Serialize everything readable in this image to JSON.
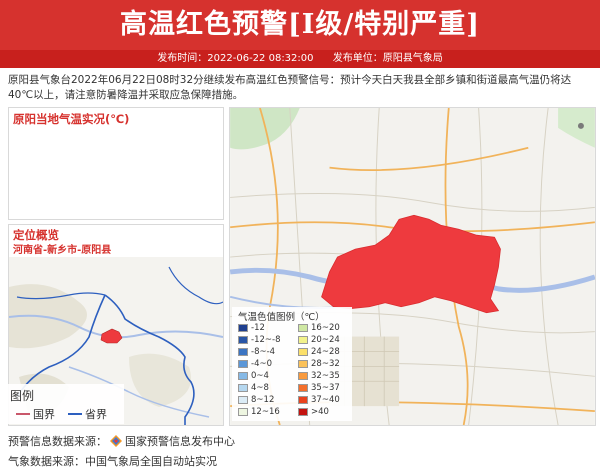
{
  "header": {
    "title": "高温红色预警[I级/特别严重]",
    "issue_time_label": "发布时间：2022-06-22 08:32:00",
    "issuer_label": "发布单位：原阳县气象局"
  },
  "description": "原阳县气象台2022年06月22日08时32分继续发布高温红色预警信号：预计今天白天我县全部乡镇和街道最高气温仍将达40℃以上，请注意防暑降温并采取应急保障措施。",
  "temp_panel": {
    "title": "原阳当地气温实况(℃)"
  },
  "location_panel": {
    "title": "定位概览",
    "subtitle": "河南省-新乡市-原阳县",
    "legend": {
      "title": "图例",
      "items": [
        {
          "label": "国界",
          "color": "#c9576a"
        },
        {
          "label": "省界",
          "color": "#2d5fbf"
        }
      ]
    }
  },
  "temp_legend": {
    "title": "气温色值图例（℃）",
    "items": [
      {
        "label": "-12",
        "color": "#1f3f8f"
      },
      {
        "label": "-12~-8",
        "color": "#2855a6"
      },
      {
        "label": "-8~-4",
        "color": "#3b74c2"
      },
      {
        "label": "-4~0",
        "color": "#5b97d8"
      },
      {
        "label": "0~4",
        "color": "#86b9e6"
      },
      {
        "label": "4~8",
        "color": "#b5d7ef"
      },
      {
        "label": "8~12",
        "color": "#dcecf6"
      },
      {
        "label": "12~16",
        "color": "#eef6e1"
      },
      {
        "label": "16~20",
        "color": "#cfe8a3"
      },
      {
        "label": "20~24",
        "color": "#f2f28b"
      },
      {
        "label": "24~28",
        "color": "#fbe06a"
      },
      {
        "label": "28~32",
        "color": "#fbc25a"
      },
      {
        "label": "32~35",
        "color": "#f89a3e"
      },
      {
        "label": "35~37",
        "color": "#f46f2b"
      },
      {
        "label": "37~40",
        "color": "#e8431e"
      },
      {
        "label": ">40",
        "color": "#c3130f"
      }
    ]
  },
  "footer": {
    "warning_source": "预警信息数据来源：",
    "warning_source_name": "国家预警信息发布中心",
    "weather_source": "气象数据来源：中国气象局全国自动站实况"
  },
  "colors": {
    "warning_red": "#d6322e",
    "region_fill": "#ee3a3e",
    "river": "#a9bfe8"
  }
}
